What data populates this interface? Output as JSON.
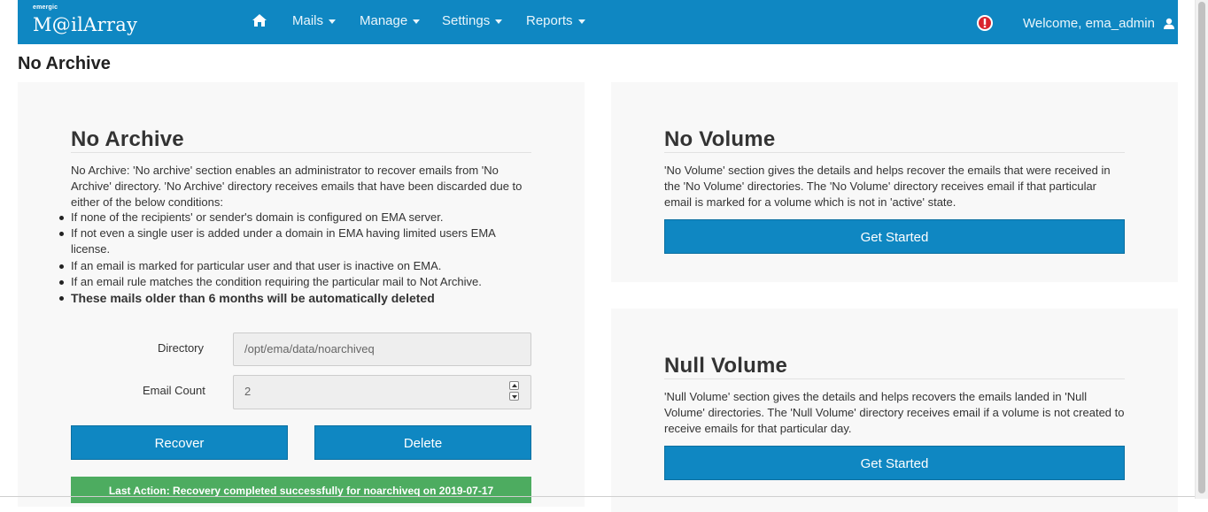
{
  "brand": {
    "tagline": "emergic",
    "name": "M@ilArray"
  },
  "nav": {
    "home_icon": "home-icon",
    "items": [
      {
        "label": "Mails"
      },
      {
        "label": "Manage"
      },
      {
        "label": "Settings"
      },
      {
        "label": "Reports"
      }
    ],
    "alert_icon": "alert-icon",
    "welcome": "Welcome, ema_admin",
    "user_icon": "user-icon"
  },
  "page_title": "No Archive",
  "no_archive": {
    "title": "No Archive",
    "intro": "No Archive: 'No archive' section enables an administrator to recover emails from 'No Archive' directory. 'No Archive' directory receives emails that have been discarded due to either of the below conditions:",
    "conditions": [
      "If none of the recipients' or sender's domain is configured on EMA server.",
      "If not even a single user is added under a domain in EMA having limited users EMA license.",
      "If an email is marked for particular user and that user is inactive on EMA.",
      "If an email rule matches the condition requiring the particular mail to Not Archive.",
      "These mails older than 6 months will be automatically deleted"
    ],
    "directory_label": "Directory",
    "directory_value": "/opt/ema/data/noarchiveq",
    "email_count_label": "Email Count",
    "email_count_value": "2",
    "recover_label": "Recover",
    "delete_label": "Delete",
    "last_action": "Last Action: Recovery completed successfully for noarchiveq on 2019-07-17"
  },
  "no_volume": {
    "title": "No Volume",
    "description": "'No Volume' section gives the details and helps recover the emails that were received in the 'No Volume' directories. The 'No Volume' directory receives email if that particular email is marked for a volume which is not in 'active' state.",
    "button_label": "Get Started"
  },
  "null_volume": {
    "title": "Null Volume",
    "description": "'Null Volume' section gives the details and helps recovers the emails landed in 'Null Volume' directories. The 'Null Volume' directory receives email if a volume is not created to receive emails for that particular day.",
    "button_label": "Get Started"
  },
  "colors": {
    "primary": "#0f87c2",
    "success": "#4dac60",
    "panel": "#f8f8f8"
  }
}
